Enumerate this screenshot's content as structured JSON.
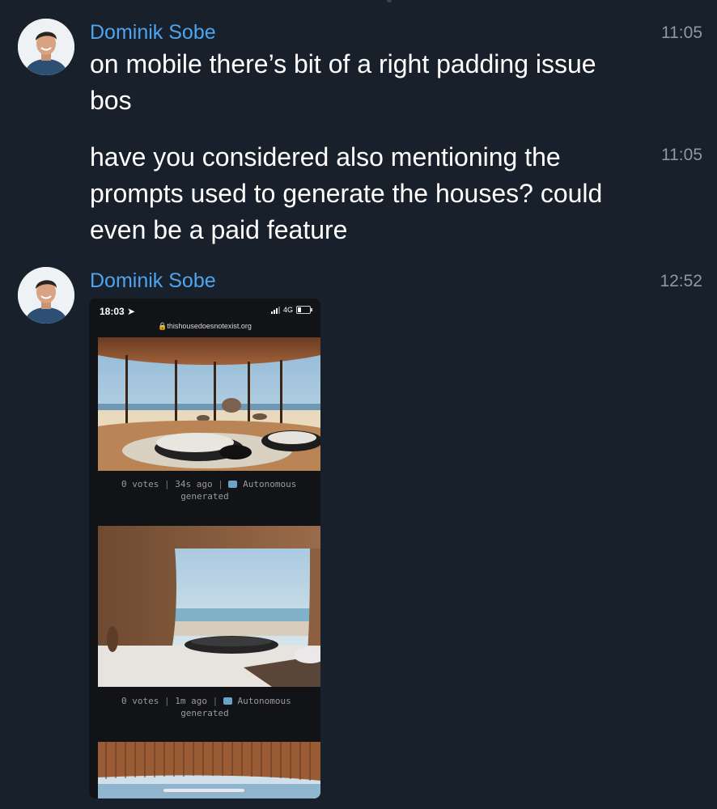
{
  "messages": [
    {
      "sender": "Dominik Sobe",
      "time": "11:05",
      "text": "on mobile there’s bit of a right padding issue bos"
    },
    {
      "time": "11:05",
      "text": "have you considered also mentioning the prompts used to generate the houses? could even be a paid feature"
    },
    {
      "sender": "Dominik Sobe",
      "time": "12:52",
      "attachment": {
        "status_time": "18:03",
        "network": "4G",
        "battery_level": 0.25,
        "url": "thishousedoesnotexist.org",
        "posts": [
          {
            "votes": "0 votes",
            "age": "34s ago",
            "source": "Autonomous",
            "source2": "generated"
          },
          {
            "votes": "0 votes",
            "age": "1m ago",
            "source": "Autonomous",
            "source2": "generated"
          }
        ]
      }
    }
  ],
  "colors": {
    "background": "#18212b",
    "sender": "#4fa3ef",
    "time": "#8b98a6",
    "text": "#ffffff"
  }
}
